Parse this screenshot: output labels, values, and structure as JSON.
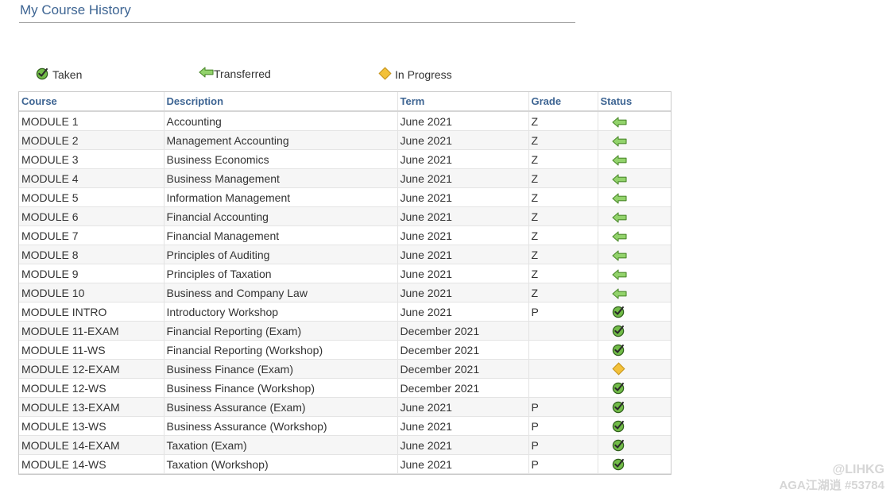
{
  "page_title": "My Course History",
  "legend": {
    "taken": {
      "label": "Taken",
      "icon": "check-circle-icon"
    },
    "transferred": {
      "label": "Transferred",
      "icon": "arrow-left-icon"
    },
    "in_progress": {
      "label": "In Progress",
      "icon": "diamond-icon"
    }
  },
  "table": {
    "headers": {
      "course": "Course",
      "description": "Description",
      "term": "Term",
      "grade": "Grade",
      "status": "Status"
    },
    "rows": [
      {
        "course": "MODULE 1",
        "description": "Accounting",
        "term": "June 2021",
        "grade": "Z",
        "status": "transferred"
      },
      {
        "course": "MODULE 2",
        "description": "Management Accounting",
        "term": "June 2021",
        "grade": "Z",
        "status": "transferred"
      },
      {
        "course": "MODULE 3",
        "description": "Business Economics",
        "term": "June 2021",
        "grade": "Z",
        "status": "transferred"
      },
      {
        "course": "MODULE 4",
        "description": "Business Management",
        "term": "June 2021",
        "grade": "Z",
        "status": "transferred"
      },
      {
        "course": "MODULE 5",
        "description": "Information Management",
        "term": "June 2021",
        "grade": "Z",
        "status": "transferred"
      },
      {
        "course": "MODULE 6",
        "description": "Financial Accounting",
        "term": "June 2021",
        "grade": "Z",
        "status": "transferred"
      },
      {
        "course": "MODULE 7",
        "description": "Financial Management",
        "term": "June 2021",
        "grade": "Z",
        "status": "transferred"
      },
      {
        "course": "MODULE 8",
        "description": "Principles of Auditing",
        "term": "June 2021",
        "grade": "Z",
        "status": "transferred"
      },
      {
        "course": "MODULE 9",
        "description": "Principles of Taxation",
        "term": "June 2021",
        "grade": "Z",
        "status": "transferred"
      },
      {
        "course": "MODULE 10",
        "description": "Business and Company Law",
        "term": "June 2021",
        "grade": "Z",
        "status": "transferred"
      },
      {
        "course": "MODULE INTRO",
        "description": "Introductory Workshop",
        "term": "June 2021",
        "grade": "P",
        "status": "taken"
      },
      {
        "course": "MODULE 11-EXAM",
        "description": "Financial Reporting (Exam)",
        "term": "December 2021",
        "grade": "",
        "status": "taken"
      },
      {
        "course": "MODULE 11-WS",
        "description": "Financial Reporting (Workshop)",
        "term": "December 2021",
        "grade": "",
        "status": "taken"
      },
      {
        "course": "MODULE 12-EXAM",
        "description": "Business Finance (Exam)",
        "term": "December 2021",
        "grade": "",
        "status": "in_progress"
      },
      {
        "course": "MODULE 12-WS",
        "description": "Business Finance (Workshop)",
        "term": "December 2021",
        "grade": "",
        "status": "taken"
      },
      {
        "course": "MODULE 13-EXAM",
        "description": "Business Assurance (Exam)",
        "term": "June 2021",
        "grade": "P",
        "status": "taken"
      },
      {
        "course": "MODULE 13-WS",
        "description": "Business Assurance (Workshop)",
        "term": "June 2021",
        "grade": "P",
        "status": "taken"
      },
      {
        "course": "MODULE 14-EXAM",
        "description": "Taxation (Exam)",
        "term": "June 2021",
        "grade": "P",
        "status": "taken"
      },
      {
        "course": "MODULE 14-WS",
        "description": "Taxation (Workshop)",
        "term": "June 2021",
        "grade": "P",
        "status": "taken"
      }
    ]
  },
  "watermark": {
    "line1": "@LIHKG",
    "line2": "AGA江湖逍 #53784"
  },
  "colors": {
    "title": "#3e6593",
    "header_text": "#3e6593",
    "taken_green": "#6fb843",
    "transferred_green": "#8fd16a",
    "in_progress_yellow": "#f3c13a"
  }
}
